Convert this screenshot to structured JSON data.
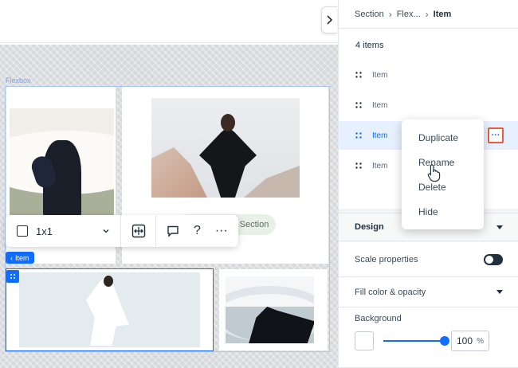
{
  "canvas": {
    "flexbox_label": "Flexbox",
    "section_button_label": "Section",
    "selected_tag_label": "Item"
  },
  "toolbar": {
    "ratio_value": "1x1",
    "help_label": "?",
    "more_label": "···"
  },
  "breadcrumb": {
    "items": [
      "Section",
      "Flex...",
      "Item"
    ]
  },
  "items_panel": {
    "count_label": "4 items",
    "items": [
      "Item",
      "Item",
      "Item",
      "Item"
    ],
    "selected_index": 2,
    "more_label": "···"
  },
  "context_menu": {
    "items": [
      "Duplicate",
      "Rename",
      "Delete",
      "Hide"
    ]
  },
  "design": {
    "header": "Design",
    "scale_properties_label": "Scale properties",
    "scale_properties_on": false,
    "fill_label": "Fill color & opacity",
    "background_label": "Background",
    "background_color": "#ffffff",
    "opacity_value": "100",
    "opacity_unit": "%",
    "opacity_fraction": 1.0
  },
  "colors": {
    "accent": "#116dff",
    "highlight": "#ef5b3c"
  }
}
